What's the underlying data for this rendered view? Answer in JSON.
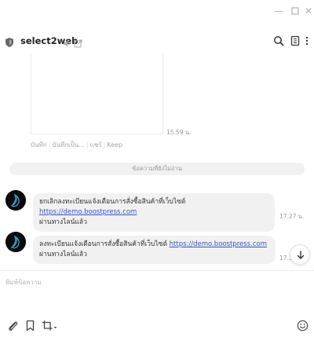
{
  "window": {
    "minimize_icon": "minimize-icon",
    "maximize_icon": "maximize-icon",
    "close_icon": "close-icon",
    "minimize_glyph": "—",
    "close_glyph": "✕"
  },
  "header": {
    "title": "select2web",
    "icons": [
      "shield-icon",
      "mute-icon",
      "external-link-icon",
      "search-icon",
      "notes-icon",
      "more-options-icon"
    ]
  },
  "media_message": {
    "time": "15.59 น.",
    "actions": [
      "บันทึก",
      "บันทึกเป็น...",
      "แชร์",
      "Keep"
    ]
  },
  "divider": {
    "label": "ข้อความที่ยังไม่อ่าน"
  },
  "messages": [
    {
      "text": "ยกเลิกลงทะเบียนแจ้งเตือนการสั่งซื้อสินค้าที่เว็บไซต์",
      "link": "https://demo.boostpress.com",
      "line2": "ผ่านทางไลน์แล้ว",
      "time": "17.27 น."
    },
    {
      "text": "ลงทะเบียนแจ้งเตือนการสั่งซื้อสินค้าที่เว็บไซต์",
      "link": "https://demo.boostpress.com",
      "line2": "ผ่านทางไลน์แล้ว",
      "time": "17.3"
    }
  ],
  "composer": {
    "placeholder": "พิมพ์ข้อความ"
  },
  "toolbar": {
    "icons": [
      "attach-icon",
      "bookmark-icon",
      "crop-icon",
      "emoji-icon"
    ]
  },
  "colors": {
    "link": "#2f57c2",
    "bubble": "#f1f1f1",
    "muted_text": "#999999"
  }
}
